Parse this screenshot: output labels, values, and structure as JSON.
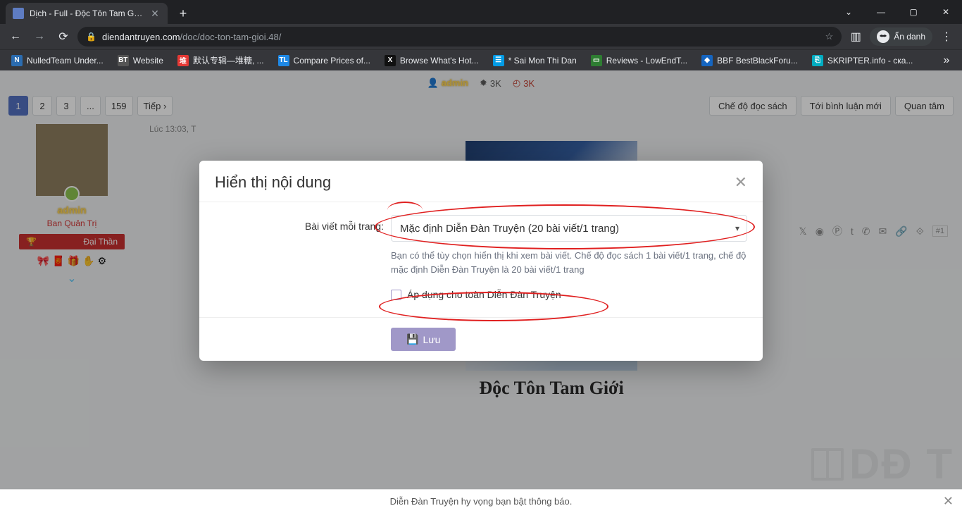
{
  "browser": {
    "tab_title": "Dịch - Full - Độc Tôn Tam Giới | D",
    "url_domain": "diendantruyen.com",
    "url_path": "/doc/doc-ton-tam-gioi.48/",
    "incognito_label": "Ẩn danh",
    "window_controls": {
      "min": "—",
      "max": "▢",
      "close": "✕",
      "chev": "⌄"
    }
  },
  "bookmarks": [
    {
      "label": "NulledTeam Under...",
      "bg": "#2b6cb0",
      "ch": "N"
    },
    {
      "label": "Website",
      "bg": "#555",
      "ch": "BT"
    },
    {
      "label": "默认专辑—堆糖,  ...",
      "bg": "#e53935",
      "ch": "堆"
    },
    {
      "label": "Compare Prices of...",
      "bg": "#1e88e5",
      "ch": "TL"
    },
    {
      "label": "Browse What's Hot...",
      "bg": "#111",
      "ch": "X"
    },
    {
      "label": "* Sai Mon Thi Dan",
      "bg": "#039be5",
      "ch": "☰"
    },
    {
      "label": "Reviews - LowEndT...",
      "bg": "#2e7d32",
      "ch": "▭"
    },
    {
      "label": "BBF BestBlackForu...",
      "bg": "#1565c0",
      "ch": "◆"
    },
    {
      "label": "SKRIPTER.info - ска...",
      "bg": "#00acc1",
      "ch": "⎘"
    }
  ],
  "page": {
    "admin_name": "admin",
    "stat1": "3K",
    "stat2": "3K",
    "pagination": [
      "1",
      "2",
      "3",
      "...",
      "159"
    ],
    "next_label": "Tiếp ›",
    "buttons": [
      "Chế độ đọc sách",
      "Tới bình luận mới",
      "Quan tâm"
    ],
    "post_time": "Lúc 13:03, T",
    "username": "admin",
    "usertitle": "Ban Quản Trị",
    "userbadge": "Đại Thần",
    "post_number": "#1",
    "novel_title": "Độc Tôn Tam Giới",
    "bottom_msg": "Diễn Đàn Truyện hy vọng bạn bật thông báo.",
    "watermark": "DĐ T"
  },
  "modal": {
    "title": "Hiển thị nội dung",
    "field_label": "Bài viết mỗi trang:",
    "select_value": "Mặc định Diễn Đàn Truyện (20 bài viết/1 trang)",
    "help": "Bạn có thể tùy chọn hiển thị khi xem bài viết. Chế độ đọc sách 1 bài viết/1 trang, chế độ mặc định Diễn Đàn Truyện là 20 bài viết/1 trang",
    "checkbox_label": "Áp dụng cho toàn Diễn Đàn Truyện",
    "save_label": "Lưu"
  }
}
